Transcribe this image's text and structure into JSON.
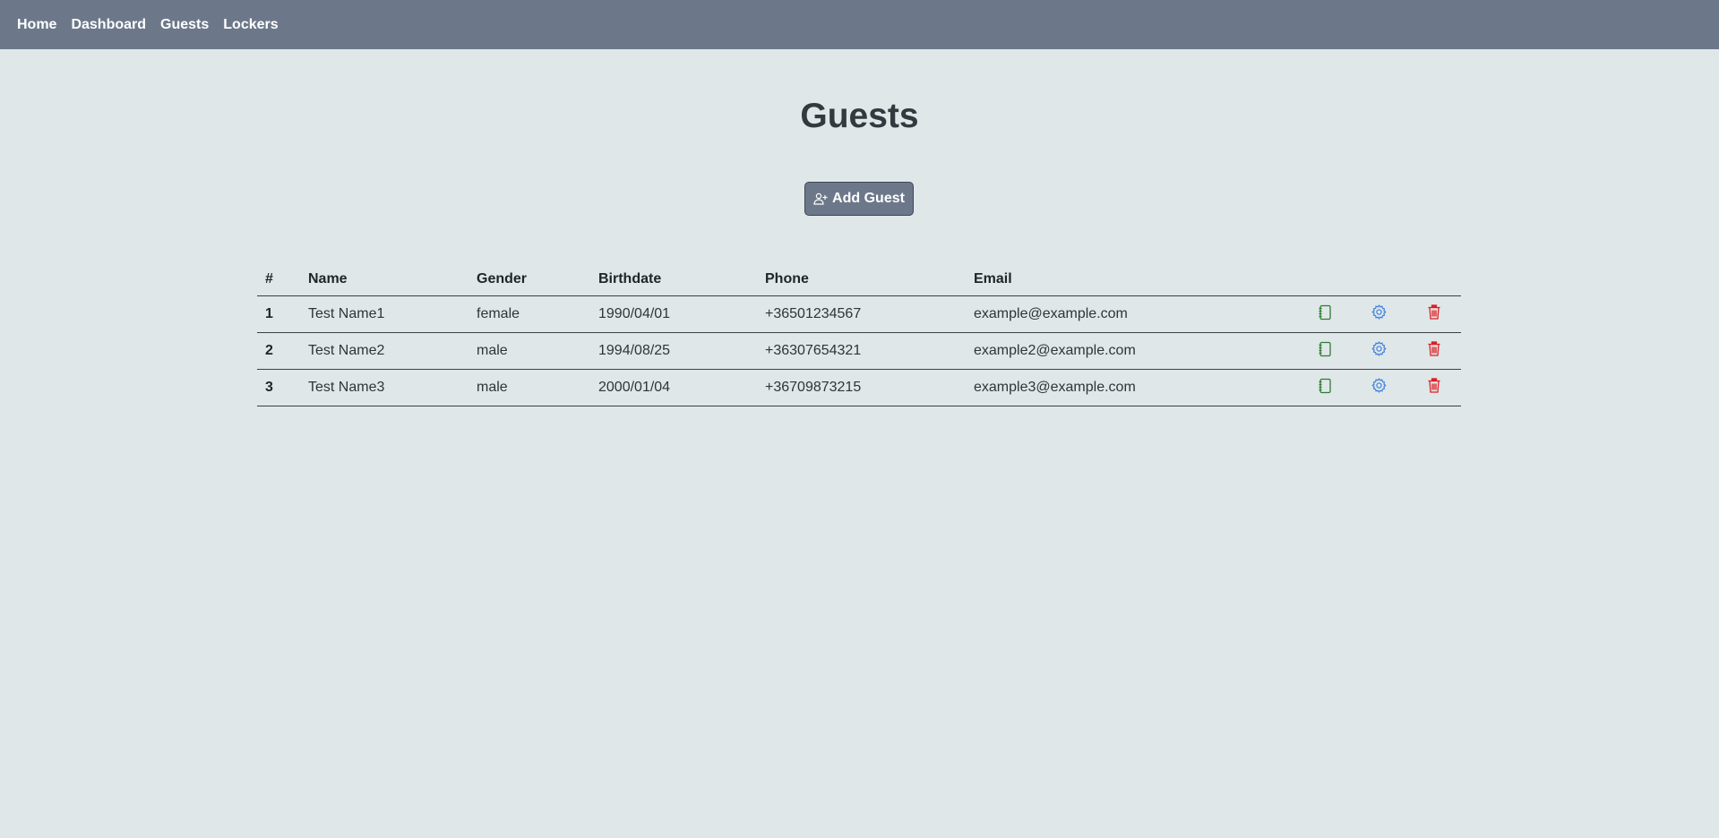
{
  "nav": {
    "items": [
      {
        "label": "Home"
      },
      {
        "label": "Dashboard"
      },
      {
        "label": "Guests"
      },
      {
        "label": "Lockers"
      }
    ]
  },
  "page": {
    "title": "Guests",
    "add_button_label": "Add Guest"
  },
  "table": {
    "headers": [
      "#",
      "Name",
      "Gender",
      "Birthdate",
      "Phone",
      "Email"
    ],
    "rows": [
      {
        "index": "1",
        "name": "Test Name1",
        "gender": "female",
        "birthdate": "1990/04/01",
        "phone": "+36501234567",
        "email": "example@example.com"
      },
      {
        "index": "2",
        "name": "Test Name2",
        "gender": "male",
        "birthdate": "1994/08/25",
        "phone": "+36307654321",
        "email": "example2@example.com"
      },
      {
        "index": "3",
        "name": "Test Name3",
        "gender": "male",
        "birthdate": "2000/01/04",
        "phone": "+36709873215",
        "email": "example3@example.com"
      }
    ]
  },
  "icons": {
    "details": "notebook-icon",
    "edit": "gear-icon",
    "delete": "trash-icon"
  },
  "colors": {
    "navbar": "#6c788a",
    "background": "#dfe7e8",
    "details_icon": "#2e7d32",
    "edit_icon": "#3b7ddd",
    "delete_icon": "#dc1f26"
  }
}
